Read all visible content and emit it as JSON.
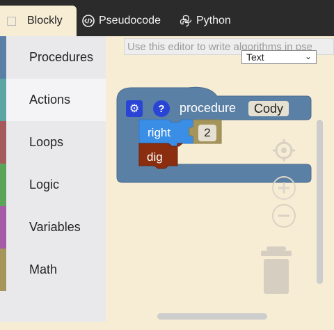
{
  "tabs": [
    {
      "label": "Blockly",
      "icon": "checkbox-icon",
      "active": true
    },
    {
      "label": "Pseudocode",
      "icon": "code-icon"
    },
    {
      "label": "Python",
      "icon": "python-icon"
    }
  ],
  "toolbox": {
    "categories": [
      {
        "label": "Procedures",
        "color": "#5b80a5"
      },
      {
        "label": "Actions",
        "color": "#5ba5a5"
      },
      {
        "label": "Loops",
        "color": "#a55b5b"
      },
      {
        "label": "Logic",
        "color": "#5ba55b"
      },
      {
        "label": "Variables",
        "color": "#a55ba5"
      },
      {
        "label": "Math",
        "color": "#a5955b"
      }
    ]
  },
  "workspace": {
    "hint": "Use this editor to write algorithms in pse",
    "language_select": "Text",
    "procedure_block": {
      "keyword": "procedure",
      "name": "Cody",
      "color": "#5b80a5",
      "statements": [
        {
          "label": "right",
          "value": "2",
          "color": "#3a8ee6"
        },
        {
          "label": "dig",
          "color": "#8b2d0f"
        }
      ]
    }
  }
}
